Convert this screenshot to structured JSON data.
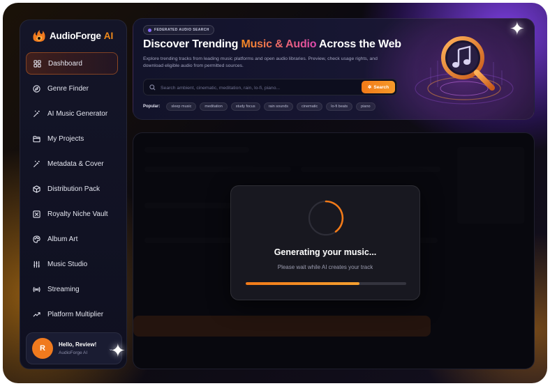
{
  "brand": {
    "name": "AudioForge",
    "suffix": "AI"
  },
  "sidebar": {
    "items": [
      {
        "label": "Dashboard",
        "icon": "grid-icon",
        "active": true
      },
      {
        "label": "Genre Finder",
        "icon": "compass-icon"
      },
      {
        "label": "AI Music Generator",
        "icon": "magic-wand-icon"
      },
      {
        "label": "My Projects",
        "icon": "folder-icon"
      },
      {
        "label": "Metadata & Cover",
        "icon": "magic-wand-icon"
      },
      {
        "label": "Distribution Pack",
        "icon": "package-icon"
      },
      {
        "label": "Royalty Niche Vault",
        "icon": "vault-icon"
      },
      {
        "label": "Album Art",
        "icon": "palette-icon"
      },
      {
        "label": "Music Studio",
        "icon": "sliders-icon"
      },
      {
        "label": "Streaming",
        "icon": "broadcast-icon"
      },
      {
        "label": "Platform Multiplier",
        "icon": "trend-up-icon"
      }
    ]
  },
  "user": {
    "initial": "R",
    "greeting": "Hello, Review!",
    "subtitle": "AudioForge AI"
  },
  "hero": {
    "tag": "FEDERATED AUDIO SEARCH",
    "title_pre": "Discover Trending ",
    "title_highlight": "Music & Audio",
    "title_post": " Across the Web",
    "description": "Explore trending tracks from leading music platforms and open audio libraries. Preview, check usage rights, and download eligible audio from permitted sources.",
    "search_placeholder": "Search ambient, cinematic, meditation, rain, lo-fi, piano...",
    "search_button": "Search",
    "popular_label": "Popular:",
    "popular_chips": [
      "sleep music",
      "meditation",
      "study focus",
      "rain sounds",
      "cinematic",
      "lo-fi beats",
      "piano"
    ]
  },
  "modal": {
    "title": "Generating your music...",
    "subtitle": "Please wait while AI creates your track",
    "progress": 0.71
  },
  "colors": {
    "accent": "#f27a18",
    "highlight_end": "#e04ab0",
    "sidebar_bg": "#141528"
  }
}
